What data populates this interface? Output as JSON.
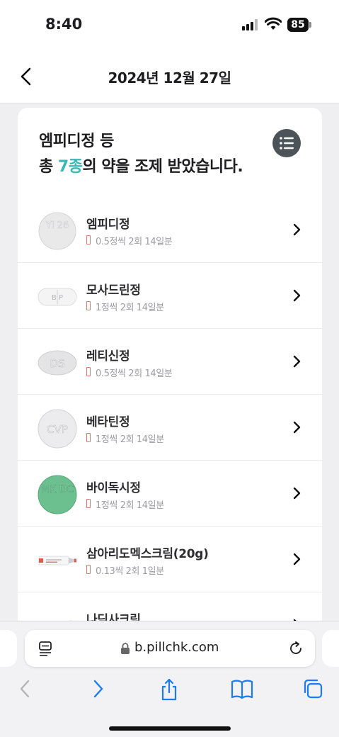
{
  "status_bar": {
    "time": "8:40",
    "battery": "85"
  },
  "header": {
    "title": "2024년 12월 27일"
  },
  "summary": {
    "line1": "엠피디정 등",
    "line2_prefix": "총 ",
    "line2_count": "7종",
    "line2_suffix": "의 약을 조제 받았습니다."
  },
  "medications": [
    {
      "name": "엠피디정",
      "dose": "0.5정씩 2회 14일분",
      "imprint": "YI 26",
      "pill_color": "#e9e9ea"
    },
    {
      "name": "모사드린정",
      "dose": "1정씩 2회 14일분",
      "imprint": "B P",
      "pill_color": "#f4f4f5"
    },
    {
      "name": "레티신정",
      "dose": "0.5정씩 2회 14일분",
      "imprint": "DS",
      "pill_color": "#e4e4e6"
    },
    {
      "name": "베타틴정",
      "dose": "1정씩 2회 14일분",
      "imprint": "CVP",
      "pill_color": "#ececee"
    },
    {
      "name": "바이독시정",
      "dose": "1정씩 2회 14일분",
      "imprint": "MK DC",
      "pill_color": "#6cbf8f"
    },
    {
      "name": "삼아리도멕스크림(20g)",
      "dose": "0.13씩 2회 1일분",
      "imprint": "",
      "pill_color": "#ffffff"
    },
    {
      "name": "나딕사크림",
      "dose": "",
      "imprint": "",
      "pill_color": "#ffffff"
    }
  ],
  "browser": {
    "url": "b.pillchk.com"
  },
  "icons": {
    "back": "chevron-left-icon",
    "list": "list-icon",
    "row_arrow": "chevron-right-icon",
    "reader": "reader-mode-icon",
    "lock": "lock-icon",
    "reload": "reload-icon",
    "nav_back": "arrow-left-icon",
    "nav_forward": "arrow-right-icon",
    "share": "share-icon",
    "bookmarks": "book-icon",
    "tabs": "tabs-icon"
  },
  "colors": {
    "accent": "#38b7b3",
    "dose_marker": "#e0776b",
    "ios_blue": "#1a7cf5"
  }
}
